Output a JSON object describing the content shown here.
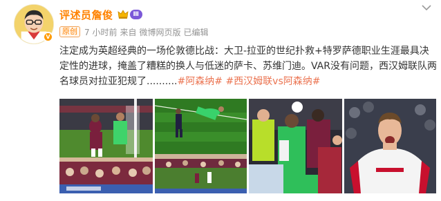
{
  "user": {
    "name": "评述员詹俊",
    "level_badge": "Ⅲ",
    "verified_badge": "V"
  },
  "meta": {
    "origin_tag": "原创",
    "time": "7 小时前",
    "source_prefix": "来自",
    "source": "微博网页版",
    "edited": "已编辑"
  },
  "post": {
    "text": "注定成为英超经典的一场伦敦德比战：大卫-拉亚的世纪扑救+特罗萨德职业生涯最具决定性的进球，掩盖了糟糕的换人与低迷的萨卡、苏维门迪。VAR没有问题，西汉姆联队两名球员对拉亚犯规了..........",
    "hashtags": [
      "#阿森纳#",
      "#西汉姆联vs阿森纳#"
    ],
    "hashtag_gap": " "
  },
  "icons": {
    "more": "more-horizontal-icon",
    "crown": "crown-icon"
  },
  "colors": {
    "username": "#ff8200",
    "hashtag": "#eb7350",
    "meta": "#939393",
    "level_badge": "#7b58d8"
  },
  "images": {
    "photo_1": "West Ham player celebrating near goal with keeper",
    "photo_2": "Goalkeeper diving save on pitch",
    "photo_3": "Players colliding with keeper in goalmouth",
    "photo_4": "Arsenal player in white shirt celebrating"
  }
}
